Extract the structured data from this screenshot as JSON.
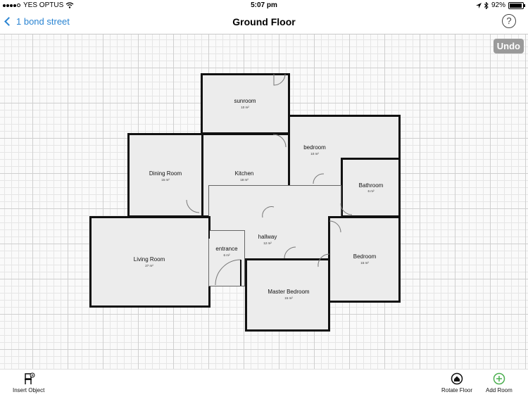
{
  "status": {
    "carrier": "YES OPTUS",
    "time": "5:07 pm",
    "battery": "92%"
  },
  "nav": {
    "back_label": "1 bond street",
    "title": "Ground Floor",
    "help_label": "?"
  },
  "canvas": {
    "undo_label": "Undo"
  },
  "rooms": [
    {
      "name": "sunroom",
      "area": "10 m²"
    },
    {
      "name": "bedroom",
      "area": "10 m²"
    },
    {
      "name": "Dining Room",
      "area": "15 m²"
    },
    {
      "name": "Kitchen",
      "area": "18 m²"
    },
    {
      "name": "Bathroom",
      "area": "6 m²"
    },
    {
      "name": "hallway",
      "area": "12 m²"
    },
    {
      "name": "Living Room",
      "area": "27 m²"
    },
    {
      "name": "entrance",
      "area": "6 m²"
    },
    {
      "name": "Bedroom",
      "area": "15 m²"
    },
    {
      "name": "Master Bedroom",
      "area": "15 m²"
    }
  ],
  "toolbar": {
    "insert": "Insert Object",
    "rotate": "Rotate Floor",
    "add": "Add Room"
  },
  "colors": {
    "accent": "#2a84d2",
    "add_green": "#4caf50",
    "wall": "#111111",
    "room_fill": "#ececec"
  }
}
